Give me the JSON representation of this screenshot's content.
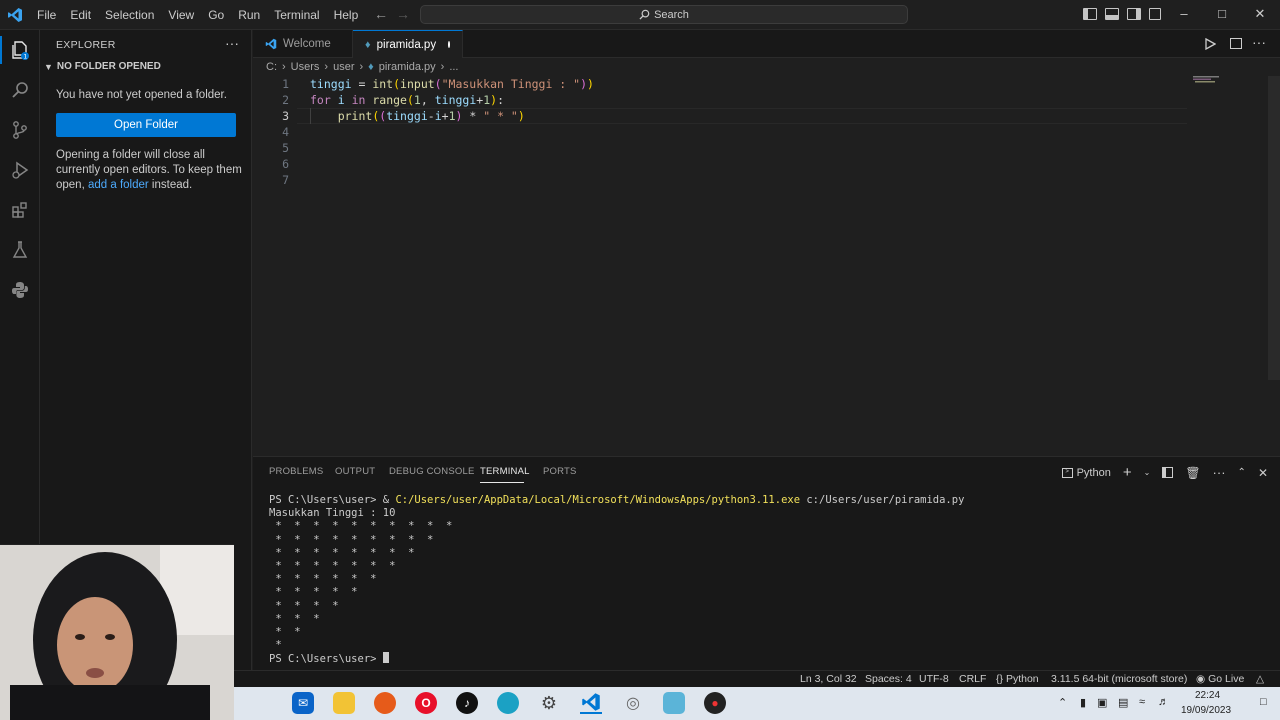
{
  "menu": [
    "File",
    "Edit",
    "Selection",
    "View",
    "Go",
    "Run",
    "Terminal",
    "Help"
  ],
  "search_label": "Search",
  "sidebar": {
    "title": "EXPLORER",
    "section": "NO FOLDER OPENED",
    "not_opened_text": "You have not yet opened a folder.",
    "open_folder_label": "Open Folder",
    "close_text_before": "Opening a folder will close all currently open editors. To keep them open, ",
    "add_folder_link": "add a folder",
    "close_text_after": " instead."
  },
  "tabs": {
    "welcome": "Welcome",
    "active": "piramida.py"
  },
  "breadcrumb": [
    "C:",
    "Users",
    "user",
    "piramida.py",
    "..."
  ],
  "line_numbers": [
    "1",
    "2",
    "3",
    "4",
    "5",
    "6",
    "7"
  ],
  "code_lines": [
    "tinggi = int(input(\"Masukkan Tinggi : \"))",
    "for i in range(1, tinggi+1):",
    "    print((tinggi-i+1) * \" * \")",
    "",
    "",
    "",
    ""
  ],
  "panel": {
    "tabs": [
      "PROBLEMS",
      "OUTPUT",
      "DEBUG CONSOLE",
      "TERMINAL",
      "PORTS"
    ],
    "active_tab": "TERMINAL",
    "shell": "Python",
    "terminal": {
      "prompt": "PS C:\\Users\\user> ",
      "command_amp": "& ",
      "command_exe": "C:/Users/user/AppData/Local/Microsoft/WindowsApps/python3.11.exe",
      "command_arg": " c:/Users/user/piramida.py",
      "input_line": "Masukkan Tinggi : 10",
      "output": [
        " *  *  *  *  *  *  *  *  *  * ",
        " *  *  *  *  *  *  *  *  * ",
        " *  *  *  *  *  *  *  * ",
        " *  *  *  *  *  *  * ",
        " *  *  *  *  *  * ",
        " *  *  *  *  * ",
        " *  *  *  * ",
        " *  *  * ",
        " *  * ",
        " * "
      ],
      "final_prompt": "PS C:\\Users\\user> "
    }
  },
  "statusbar": {
    "position": "Ln 3, Col 32",
    "spaces": "Spaces: 4",
    "encoding": "UTF-8",
    "eol": "CRLF",
    "language": "Python",
    "interpreter": "3.11.5 64-bit (microsoft store)",
    "golive": "Go Live"
  },
  "clock": {
    "time": "22:24",
    "date": "19/09/2023"
  },
  "colors": {
    "accent": "#0078d4",
    "editor_bg": "#1f1f1f",
    "sidebar_bg": "#181818",
    "keyword": "#c586c0",
    "function": "#dcdcaa",
    "string": "#ce9178"
  }
}
